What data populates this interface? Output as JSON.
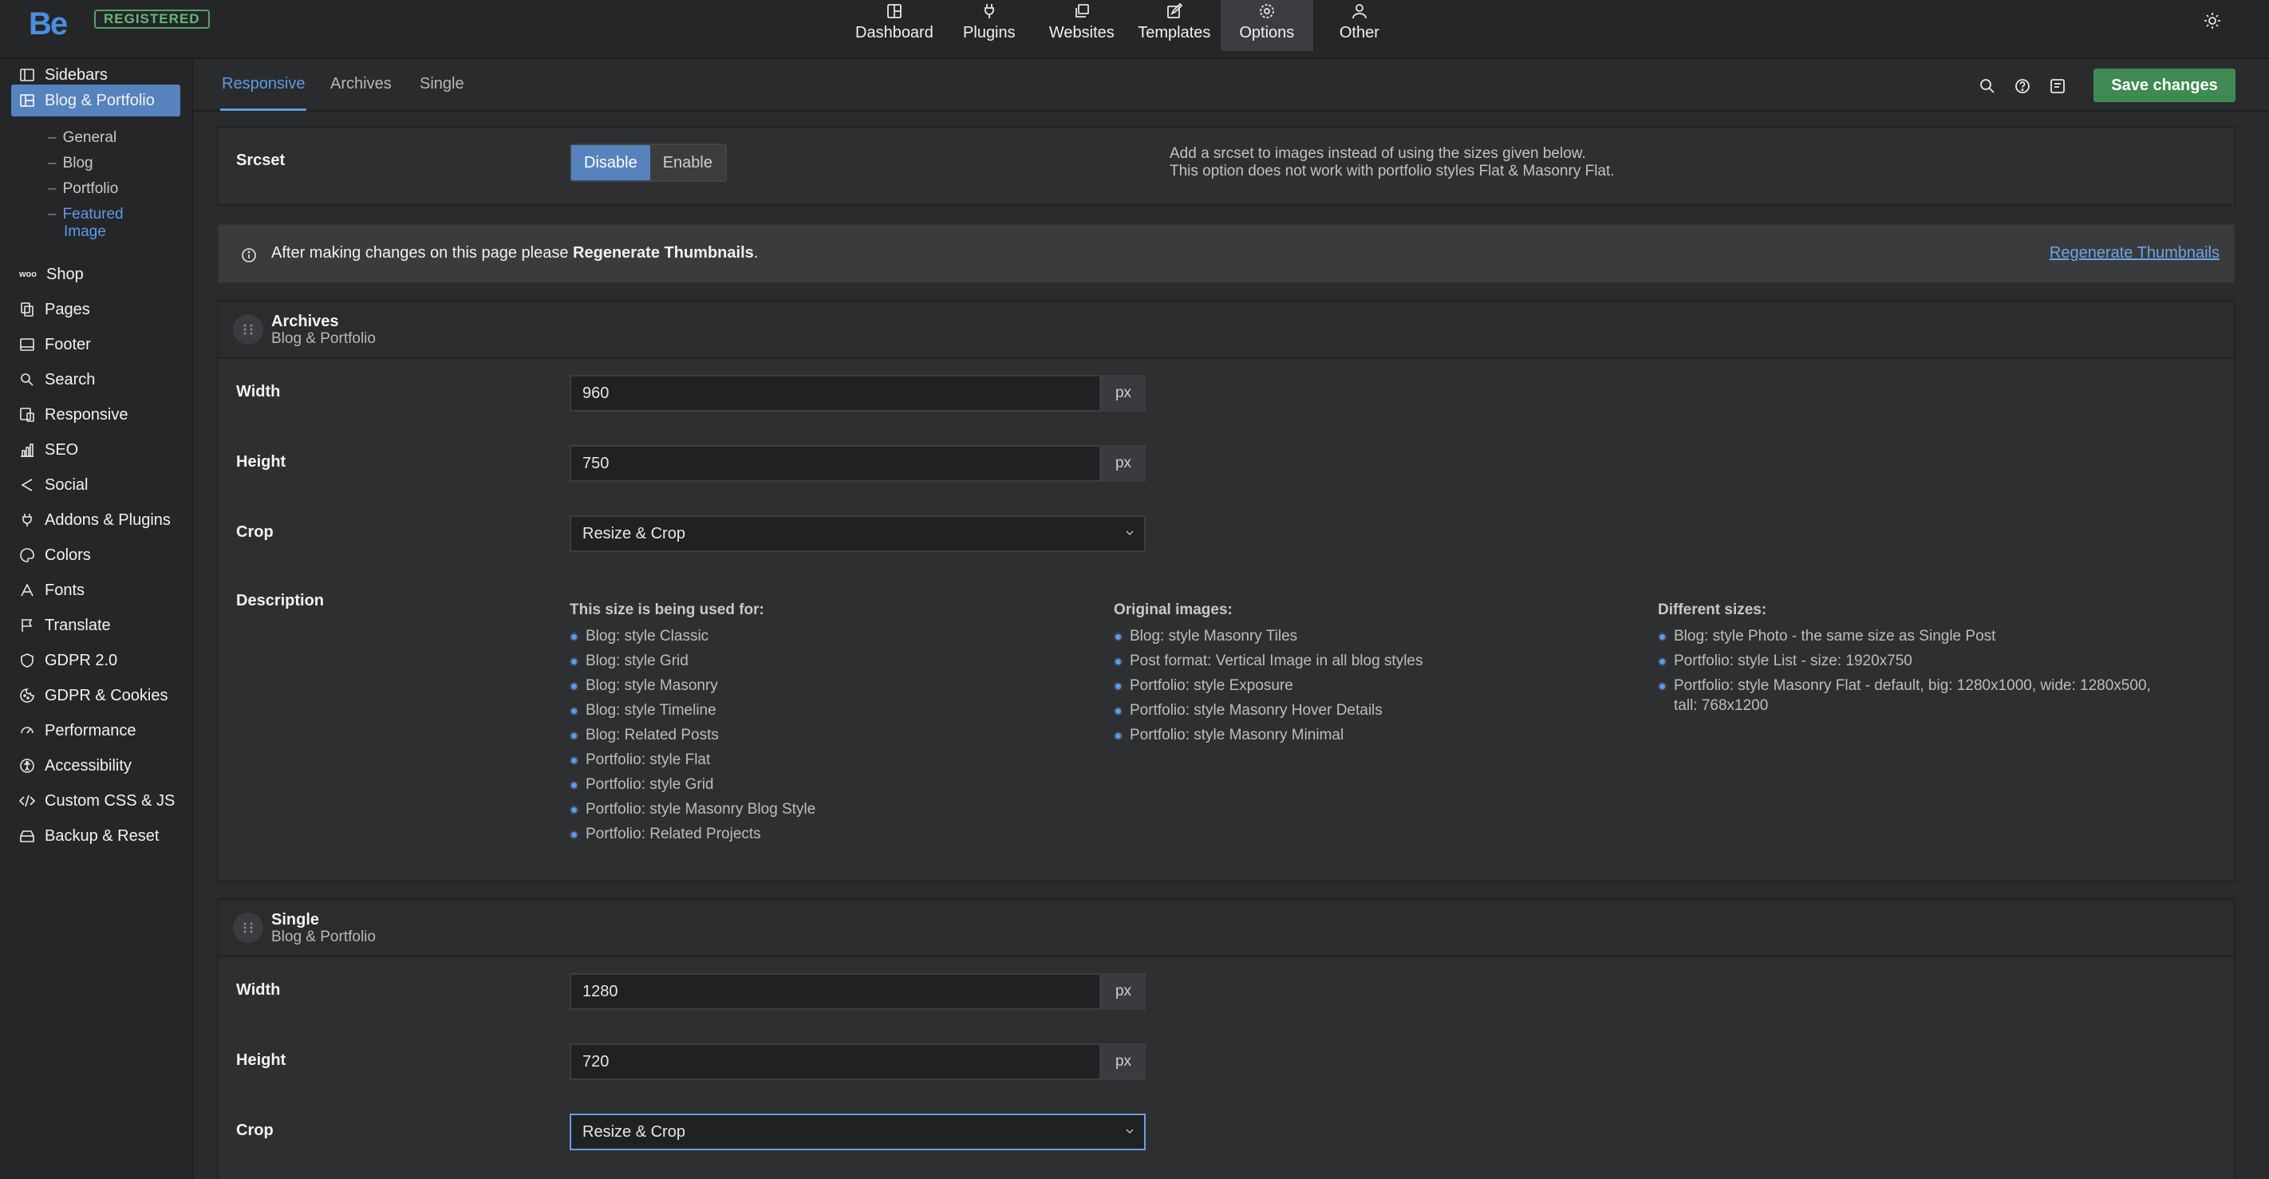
{
  "topbar": {
    "logo": "Be",
    "badge": "REGISTERED",
    "nav": [
      {
        "label": "Dashboard",
        "icon": "dashboard-icon"
      },
      {
        "label": "Plugins",
        "icon": "plug-icon"
      },
      {
        "label": "Websites",
        "icon": "websites-icon"
      },
      {
        "label": "Templates",
        "icon": "templates-icon"
      },
      {
        "label": "Options",
        "icon": "gear-icon",
        "active": true
      },
      {
        "label": "Other",
        "icon": "user-icon"
      }
    ]
  },
  "sidebar": {
    "items": [
      {
        "label": "Sidebars"
      },
      {
        "label": "Blog & Portfolio",
        "active": true
      },
      {
        "label": "Shop"
      },
      {
        "label": "Pages"
      },
      {
        "label": "Footer"
      },
      {
        "label": "Search"
      },
      {
        "label": "Responsive"
      },
      {
        "label": "SEO"
      },
      {
        "label": "Social"
      },
      {
        "label": "Addons & Plugins"
      },
      {
        "label": "Colors"
      },
      {
        "label": "Fonts"
      },
      {
        "label": "Translate"
      },
      {
        "label": "GDPR 2.0"
      },
      {
        "label": "GDPR & Cookies"
      },
      {
        "label": "Performance"
      },
      {
        "label": "Accessibility"
      },
      {
        "label": "Custom CSS & JS"
      },
      {
        "label": "Backup & Reset"
      }
    ],
    "subitems": [
      "General",
      "Blog",
      "Portfolio",
      "Featured",
      "Image"
    ],
    "shop_prefix": "woo"
  },
  "tabs": [
    "Responsive",
    "Archives",
    "Single"
  ],
  "save_label": "Save changes",
  "srcset": {
    "label": "Srcset",
    "options": [
      "Disable",
      "Enable"
    ],
    "help_line1": "Add a srcset to images instead of using the sizes given below.",
    "help_line2": "This option does not work with portfolio styles Flat & Masonry Flat."
  },
  "notice": {
    "text": "After making changes on this page please",
    "bold": "Regenerate Thumbnails",
    "dot": ".",
    "link": "Regenerate Thumbnails"
  },
  "archives": {
    "title": "Archives",
    "subtitle": "Blog & Portfolio",
    "width_label": "Width",
    "width_value": "960",
    "height_label": "Height",
    "height_value": "750",
    "unit": "px",
    "crop_label": "Crop",
    "crop_value": "Resize & Crop",
    "desc_label": "Description",
    "col1_title": "This size is being used for:",
    "col1": [
      "Blog: style Classic",
      "Blog: style Grid",
      "Blog: style Masonry",
      "Blog: style Timeline",
      "Blog: Related Posts",
      "Portfolio: style Flat",
      "Portfolio: style Grid",
      "Portfolio: style Masonry Blog Style",
      "Portfolio: Related Projects"
    ],
    "col2_title": "Original images:",
    "col2": [
      "Blog: style Masonry Tiles",
      "Post format: Vertical Image in all blog styles",
      "Portfolio: style Exposure",
      "Portfolio: style Masonry Hover Details",
      "Portfolio: style Masonry Minimal"
    ],
    "col3_title": "Different sizes:",
    "col3": [
      "Blog: style Photo - the same size as Single Post",
      "Portfolio: style List - size: 1920x750",
      "Portfolio: style Masonry Flat - default, big: 1280x1000, wide: 1280x500,",
      "tall: 768x1200"
    ]
  },
  "single": {
    "title": "Single",
    "subtitle": "Blog & Portfolio",
    "width_label": "Width",
    "width_value": "1280",
    "height_label": "Height",
    "height_value": "720",
    "unit": "px",
    "crop_label": "Crop",
    "crop_value": "Resize & Crop"
  }
}
